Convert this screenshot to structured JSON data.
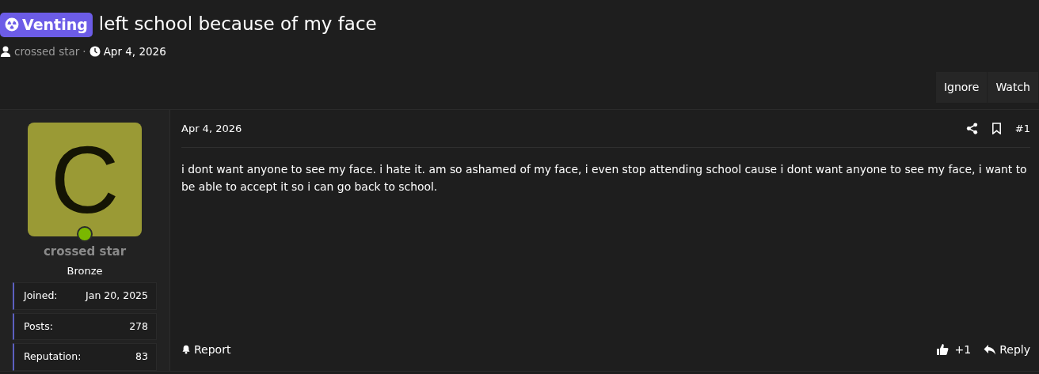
{
  "thread": {
    "prefix": "Venting",
    "title": "left school because of my face",
    "author": "crossed star",
    "separator": "·",
    "date": "Apr 4, 2026"
  },
  "actions": [
    "Ignore",
    "Watch"
  ],
  "post": {
    "user": {
      "avatar_letter": "C",
      "online": true,
      "name": "crossed star",
      "rank": "Bronze",
      "stats": [
        {
          "label": "Joined:",
          "value": "Jan 20, 2025"
        },
        {
          "label": "Posts:",
          "value": "278"
        },
        {
          "label": "Reputation:",
          "value": "83"
        }
      ]
    },
    "date": "Apr 4, 2026",
    "number": "#1",
    "body": "i dont want anyone to see my face. i hate it. am so ashamed of my face, i even stop attending school cause i dont want anyone to see my face, i want to be able to accept it so i can go back to school.",
    "report": "Report",
    "likes": "+1",
    "reply": "Reply"
  }
}
